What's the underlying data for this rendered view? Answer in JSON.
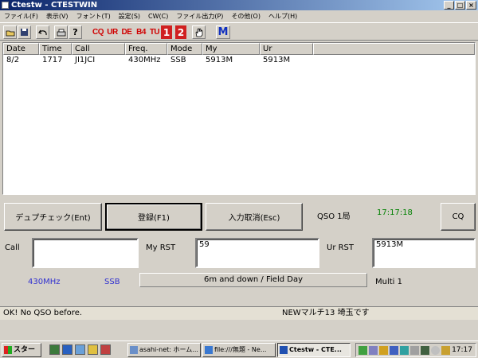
{
  "window": {
    "title": "Ctestw - CTESTWIN",
    "controls": {
      "minimize": "_",
      "maximize": "□",
      "close": "×"
    }
  },
  "menu": [
    "ファイル(F)",
    "表示(V)",
    "フォント(T)",
    "設定(S)",
    "CW(C)",
    "ファイル出力(P)",
    "その他(O)",
    "ヘルプ(H)"
  ],
  "toolbar": {
    "icons": [
      "open-icon",
      "save-icon",
      "undo-icon",
      "print-icon",
      "help-icon"
    ],
    "cw_keys": [
      "CQ",
      "UR",
      "DE",
      "B4",
      "TU"
    ],
    "num_keys": [
      "1",
      "2"
    ],
    "hand_icon": "hand-icon",
    "m_label": "M"
  },
  "log": {
    "columns": [
      "Date",
      "Time",
      "Call",
      "Freq.",
      "Mode",
      "My",
      "Ur"
    ],
    "rows": [
      [
        "8/2",
        "1717",
        "JI1JCI",
        "430MHz",
        "SSB",
        "5913M",
        "5913M"
      ]
    ]
  },
  "buttons": {
    "dupe": "デュプチェック(Ent)",
    "register": "登録(F1)",
    "cancel": "入力取消(Esc)",
    "cq": "CQ"
  },
  "info": {
    "qso_count": "QSO 1局",
    "time": "17:17:18",
    "freq": "430MHz",
    "mode": "SSB",
    "band_range": "6m and down / Field Day",
    "multi": "Multi 1"
  },
  "form": {
    "call_label": "Call",
    "call_value": "",
    "my_rst_label": "My RST",
    "my_rst_value": "59",
    "ur_rst_label": "Ur RST",
    "ur_rst_value": "5913M"
  },
  "status": {
    "left": "OK! No QSO before.",
    "right": "NEWマルチ13 埼玉です"
  },
  "taskbar": {
    "start": "スタート",
    "tasks": [
      "asahi-net: ホーム...",
      "file:///無題 - Ne...",
      "Ctestw - CTE..."
    ],
    "clock": "17:17"
  },
  "colors": {
    "title_start": "#0a246a",
    "title_end": "#a6caf0",
    "time_green": "#008000",
    "info_blue": "#3030d0",
    "cw_red": "#d00000"
  }
}
